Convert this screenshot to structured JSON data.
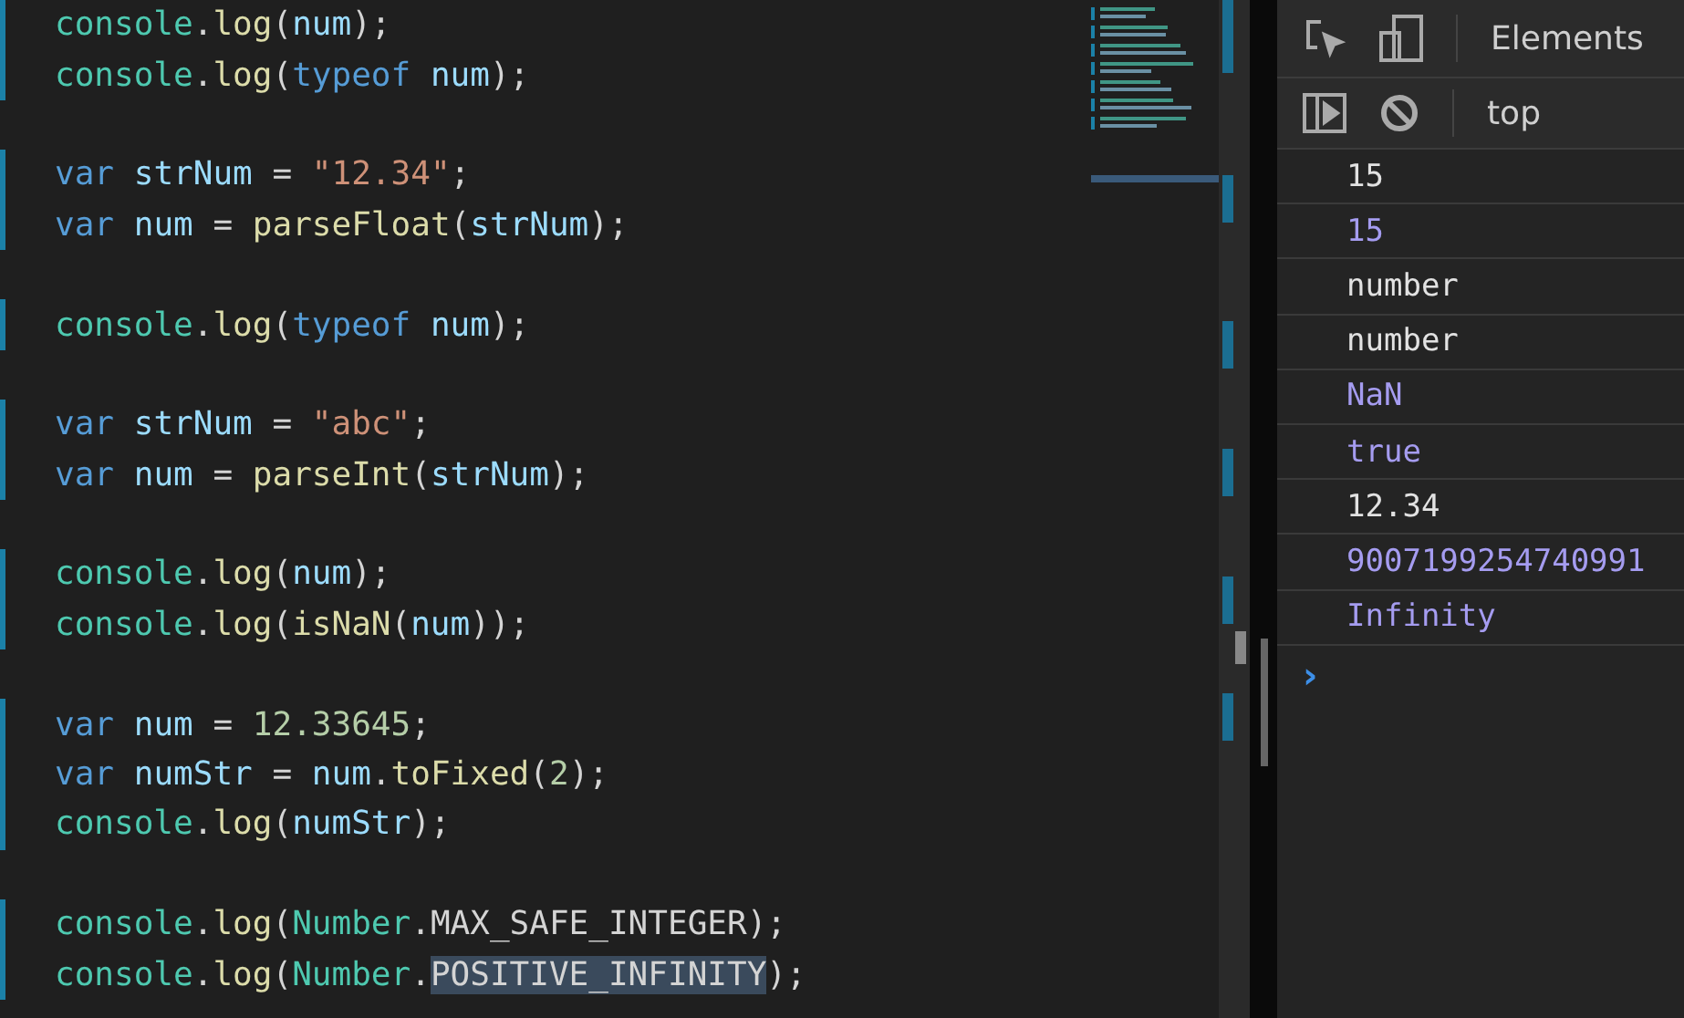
{
  "editor": {
    "lines": [
      {
        "changed": true,
        "text": "console.log(num);"
      },
      {
        "changed": true,
        "text": "console.log(typeof num);"
      },
      {
        "changed": false
      },
      {
        "changed": true,
        "text": "var strNum = \"12.34\";"
      },
      {
        "changed": true,
        "text": "var num = parseFloat(strNum);"
      },
      {
        "changed": false
      },
      {
        "changed": true,
        "text": "console.log(typeof num);"
      },
      {
        "changed": false
      },
      {
        "changed": true,
        "text": "var strNum = \"abc\";"
      },
      {
        "changed": true,
        "text": "var num = parseInt(strNum);"
      },
      {
        "changed": false
      },
      {
        "changed": true,
        "text": "console.log(num);"
      },
      {
        "changed": true,
        "text": "console.log(isNaN(num));"
      },
      {
        "changed": false
      },
      {
        "changed": true,
        "text": "var num = 12.33645;"
      },
      {
        "changed": true,
        "text": "var numStr = num.toFixed(2);"
      },
      {
        "changed": true,
        "text": "console.log(numStr);"
      },
      {
        "changed": false
      },
      {
        "changed": true,
        "text": "console.log(Number.MAX_SAFE_INTEGER);"
      },
      {
        "changed": true,
        "text": "console.log(Number.",
        "selected_text": "POSITIVE_INFINITY",
        "text_after": ");"
      }
    ]
  },
  "devtools": {
    "tab": "Elements",
    "context": "top",
    "console": [
      {
        "text": "15",
        "kind": "text"
      },
      {
        "text": "15",
        "kind": "value"
      },
      {
        "text": "number",
        "kind": "text"
      },
      {
        "text": "number",
        "kind": "text"
      },
      {
        "text": "NaN",
        "kind": "value"
      },
      {
        "text": "true",
        "kind": "value"
      },
      {
        "text": "12.34",
        "kind": "text"
      },
      {
        "text": "9007199254740991",
        "kind": "value"
      },
      {
        "text": "Infinity",
        "kind": "value"
      }
    ],
    "prompt": "›"
  }
}
